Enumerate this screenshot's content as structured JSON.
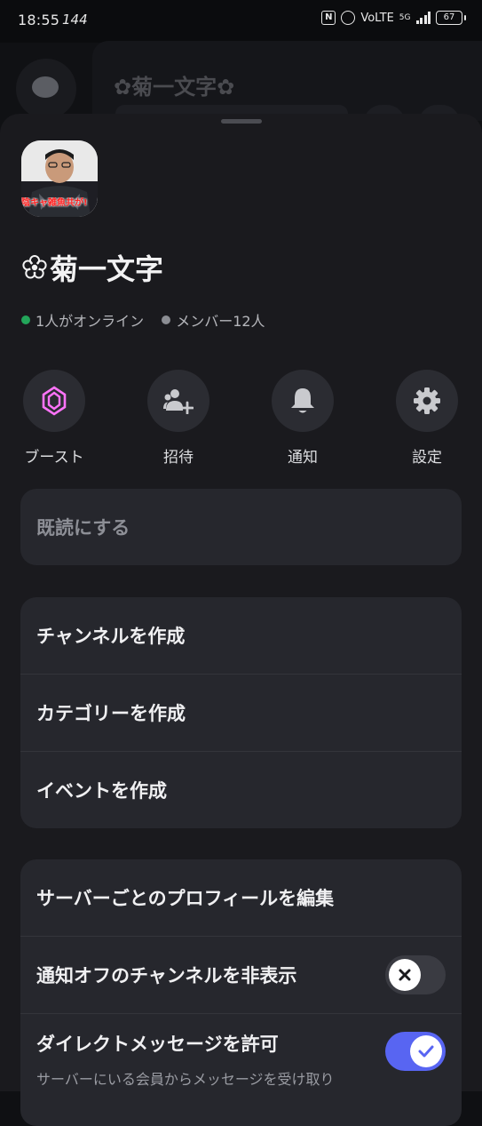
{
  "status_bar": {
    "time": "18:55",
    "refresh": "144",
    "network": "VoLTE",
    "gen": "5G",
    "battery": "67"
  },
  "background": {
    "title": "✿菊一文字✿"
  },
  "server": {
    "icon_caption": "陰キャ雑魚共が!",
    "name": "菊一文字",
    "online": "1人がオンライン",
    "members": "メンバー12人"
  },
  "actions": [
    {
      "label": "ブースト",
      "icon": "boost-icon"
    },
    {
      "label": "招待",
      "icon": "invite-icon"
    },
    {
      "label": "通知",
      "icon": "bell-icon"
    },
    {
      "label": "設定",
      "icon": "gear-icon"
    }
  ],
  "menu": {
    "mark_read": "既読にする",
    "create_channel": "チャンネルを作成",
    "create_category": "カテゴリーを作成",
    "create_event": "イベントを作成",
    "edit_profile": "サーバーごとのプロフィールを編集",
    "hide_muted": "通知オフのチャンネルを非表示",
    "allow_dm": "ダイレクトメッセージを許可",
    "allow_dm_sub": "サーバーにいる会員からメッセージを受け取り"
  },
  "toggles": {
    "hide_muted": false,
    "allow_dm": true
  },
  "colors": {
    "boost": "#ff73fa",
    "accent": "#5865f2",
    "online": "#23a55a"
  }
}
